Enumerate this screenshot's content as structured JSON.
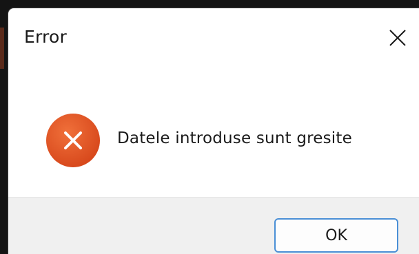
{
  "dialog": {
    "title": "Error",
    "message": "Datele introduse sunt gresite",
    "ok_label": "OK",
    "icon": "error-icon",
    "close_icon": "close-icon"
  },
  "colors": {
    "error_icon_fill": "#e0501e",
    "ok_button_border": "#4a8fd6",
    "footer_background": "#f0f0f0",
    "dialog_background": "#ffffff"
  }
}
